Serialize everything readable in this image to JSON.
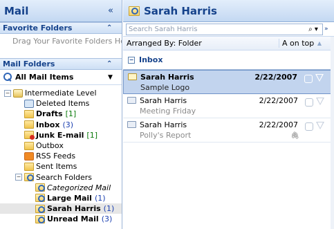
{
  "nav": {
    "title": "Mail",
    "collapse_glyph": "«",
    "favorite_folders": {
      "label": "Favorite Folders",
      "chevron": "⌃",
      "hint": "Drag Your Favorite Folders Here"
    },
    "mail_folders": {
      "label": "Mail Folders",
      "chevron": "⌃"
    },
    "all_mail_items": {
      "label": "All Mail Items",
      "dropdown": "▼"
    },
    "tree": [
      {
        "label": "Intermediate Level",
        "count": "",
        "indent": 0,
        "expander": "−",
        "icon": "org"
      },
      {
        "label": "Deleted Items",
        "count": "",
        "indent": 1,
        "expander": "",
        "icon": "trash"
      },
      {
        "label": "Drafts",
        "count": "[1]",
        "indent": 1,
        "expander": "",
        "icon": "folder",
        "bold": true
      },
      {
        "label": "Inbox",
        "count": "(3)",
        "indent": 1,
        "expander": "",
        "icon": "folder",
        "bold": true,
        "count_blue": true
      },
      {
        "label": "Junk E-mail",
        "count": "[1]",
        "indent": 1,
        "expander": "",
        "icon": "junk",
        "bold": true
      },
      {
        "label": "Outbox",
        "count": "",
        "indent": 1,
        "expander": "",
        "icon": "folder"
      },
      {
        "label": "RSS Feeds",
        "count": "",
        "indent": 1,
        "expander": "",
        "icon": "rss"
      },
      {
        "label": "Sent Items",
        "count": "",
        "indent": 1,
        "expander": "",
        "icon": "folder"
      },
      {
        "label": "Search Folders",
        "count": "",
        "indent": 1,
        "expander": "−",
        "icon": "search"
      },
      {
        "label": "Categorized Mail",
        "count": "",
        "indent": 2,
        "expander": "",
        "icon": "search",
        "italic": true
      },
      {
        "label": "Large Mail",
        "count": "(1)",
        "indent": 2,
        "expander": "",
        "icon": "search",
        "bold": true,
        "count_blue": true
      },
      {
        "label": "Sarah Harris",
        "count": "(1)",
        "indent": 2,
        "expander": "",
        "icon": "search",
        "bold": true,
        "count_blue": true,
        "selected": true
      },
      {
        "label": "Unread Mail",
        "count": "(3)",
        "indent": 2,
        "expander": "",
        "icon": "search",
        "bold": true,
        "count_blue": true
      }
    ]
  },
  "main": {
    "title": "Sarah Harris",
    "search_placeholder": "Search Sarah Harris",
    "search_button": "⌕ ▾",
    "expand_glyph": "»",
    "arranged_by": "Arranged By: Folder",
    "order": "A on top",
    "order_arrow": "▲",
    "group": {
      "label": "Inbox",
      "expander": "−"
    },
    "messages": [
      {
        "from": "Sarah Harris",
        "subject": "Sample Logo",
        "date": "2/22/2007",
        "selected": true,
        "attachment": false
      },
      {
        "from": "Sarah Harris",
        "subject": "Meeting Friday",
        "date": "2/22/2007",
        "selected": false,
        "attachment": false
      },
      {
        "from": "Sarah Harris",
        "subject": "Polly's Report",
        "date": "2/22/2007",
        "selected": false,
        "attachment": true
      }
    ]
  }
}
